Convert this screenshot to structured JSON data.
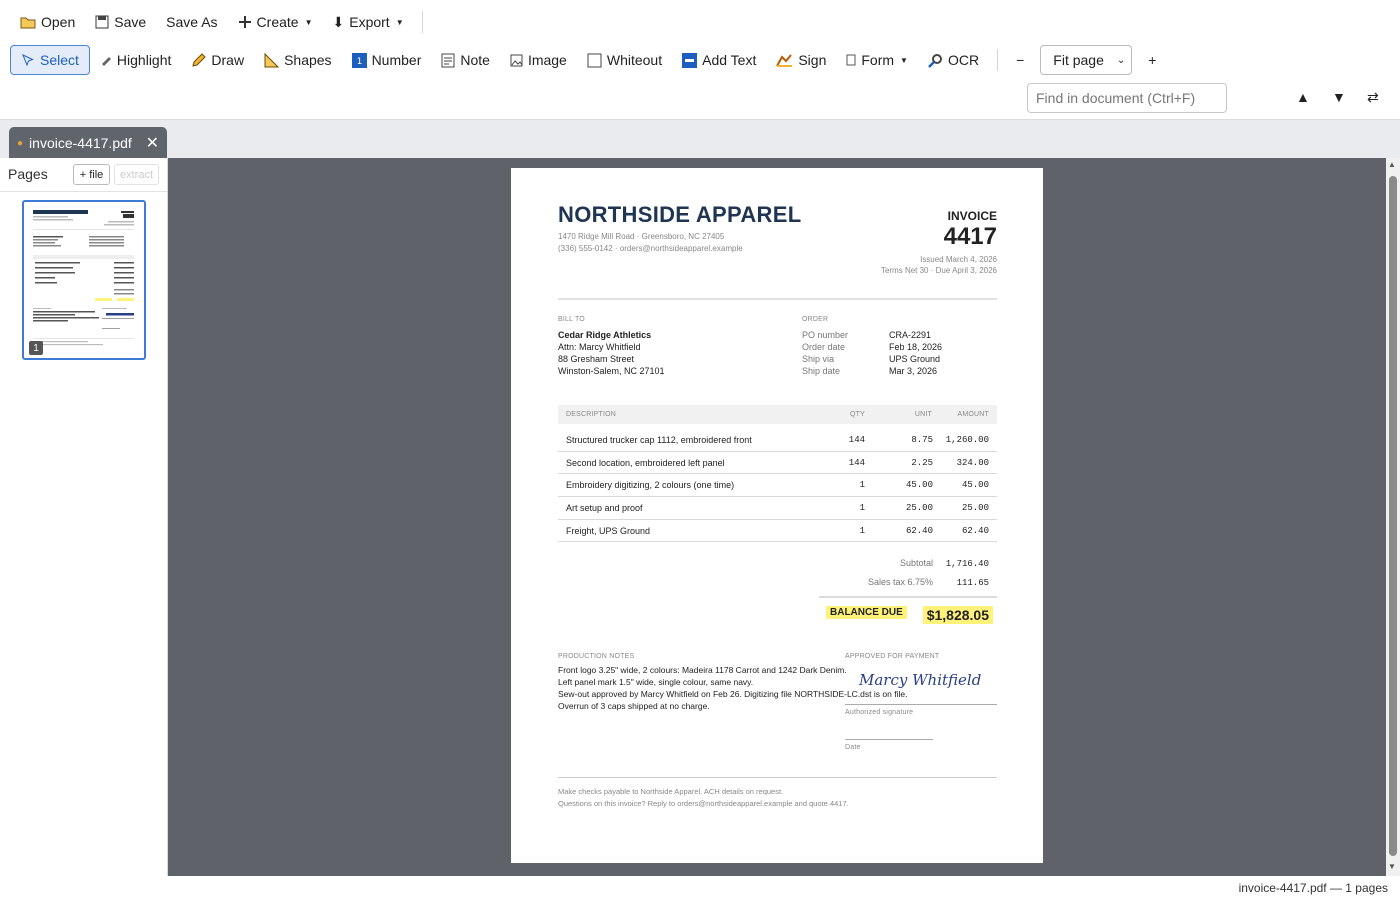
{
  "toolbar": {
    "row1": [
      {
        "label": "Open",
        "icon": "folder-icon"
      },
      {
        "label": "Save",
        "icon": "save-icon"
      },
      {
        "label": "Save As",
        "icon": ""
      },
      {
        "label": "Create",
        "icon": "plus-icon",
        "caret": true
      },
      {
        "label": "Export",
        "icon": "download-icon",
        "caret": true
      }
    ],
    "row2": [
      {
        "label": "Select",
        "icon": "select-icon",
        "active": true
      },
      {
        "label": "Highlight",
        "icon": "highlight-icon"
      },
      {
        "label": "Draw",
        "icon": "pencil-icon"
      },
      {
        "label": "Shapes",
        "icon": "shapes-icon"
      },
      {
        "label": "Number",
        "icon": "number-icon"
      },
      {
        "label": "Note",
        "icon": "note-icon"
      },
      {
        "label": "Image",
        "icon": "image-icon"
      },
      {
        "label": "Whiteout",
        "icon": "whiteout-icon"
      },
      {
        "label": "Add Text",
        "icon": "add-text-icon"
      },
      {
        "label": "Sign",
        "icon": "sign-icon"
      },
      {
        "label": "Form",
        "icon": "form-icon",
        "caret": true
      },
      {
        "label": "OCR",
        "icon": "ocr-icon"
      }
    ],
    "zoom_minus": "−",
    "zoom_value": "Fit page",
    "zoom_plus": "+"
  },
  "search": {
    "placeholder": "Find in document (Ctrl+F)",
    "prev": "▲",
    "next": "▼",
    "swap": "⇄"
  },
  "tab": {
    "name": "invoice-4417.pdf",
    "close": "✕"
  },
  "sidebar": {
    "title": "Pages",
    "add_file": "+ file",
    "extract": "extract",
    "page_number": "1"
  },
  "status": "invoice-4417.pdf — 1 pages",
  "invoice": {
    "company": "NORTHSIDE APPAREL",
    "address": "1470 Ridge Mill Road · Greensboro, NC 27405",
    "contact": "(336) 555-0142 · orders@northsideapparel.example",
    "doc_label": "INVOICE",
    "number": "4417",
    "issued": "Issued  March 4, 2026",
    "terms": "Terms  Net 30 · Due April 3, 2026",
    "bill_to_label": "BILL TO",
    "bill_to": [
      "Cedar Ridge Athletics",
      "Attn: Marcy Whitfield",
      "88 Gresham Street",
      "Winston-Salem, NC 27101"
    ],
    "order_label": "ORDER",
    "order": [
      {
        "k": "PO number",
        "v": "CRA-2291"
      },
      {
        "k": "Order date",
        "v": "Feb 18, 2026"
      },
      {
        "k": "Ship via",
        "v": "UPS Ground"
      },
      {
        "k": "Ship date",
        "v": "Mar 3, 2026"
      }
    ],
    "columns": [
      "DESCRIPTION",
      "QTY",
      "UNIT",
      "AMOUNT"
    ],
    "lines": [
      {
        "desc": "Structured trucker cap 1112, embroidered front",
        "qty": "144",
        "unit": "8.75",
        "amount": "1,260.00"
      },
      {
        "desc": "Second location, embroidered left panel",
        "qty": "144",
        "unit": "2.25",
        "amount": "324.00"
      },
      {
        "desc": "Embroidery digitizing, 2 colours (one time)",
        "qty": "1",
        "unit": "45.00",
        "amount": "45.00"
      },
      {
        "desc": "Art setup and proof",
        "qty": "1",
        "unit": "25.00",
        "amount": "25.00"
      },
      {
        "desc": "Freight, UPS Ground",
        "qty": "1",
        "unit": "62.40",
        "amount": "62.40"
      }
    ],
    "subtotal_label": "Subtotal",
    "subtotal": "1,716.40",
    "tax_label": "Sales tax  6.75%",
    "tax": "111.65",
    "balance_label": "BALANCE DUE",
    "balance": "$1,828.05",
    "notes_label": "PRODUCTION NOTES",
    "notes": [
      "Front logo 3.25\" wide, 2 colours: Madeira 1178 Carrot and 1242 Dark Denim.",
      "Left panel mark 1.5\" wide, single colour, same navy.",
      "Sew-out approved by Marcy Whitfield on Feb 26. Digitizing file NORTHSIDE-LC.dst is on file.",
      "Overrun of 3 caps shipped at no charge."
    ],
    "approved_label": "APPROVED FOR PAYMENT",
    "signature": "Marcy Whitfield",
    "sig_caption": "Authorized signature",
    "date_caption": "Date",
    "footer1": "Make checks payable to Northside Apparel.  ACH details on request.",
    "footer2": "Questions on this invoice? Reply to orders@northsideapparel.example and quote 4417."
  }
}
